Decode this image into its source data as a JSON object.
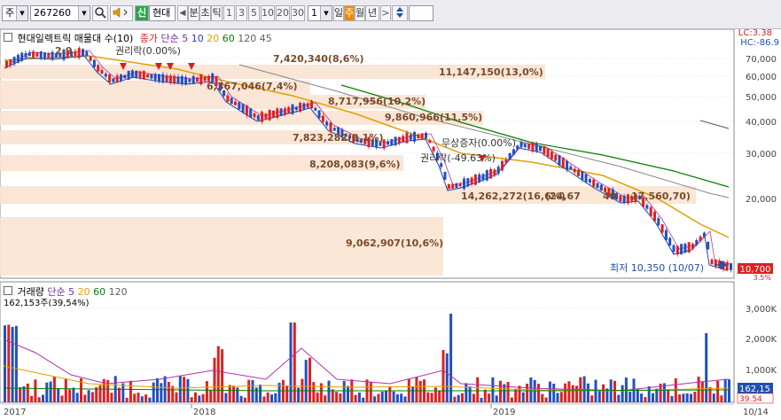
{
  "toolbar": {
    "market": "주",
    "code": "267260",
    "search_icon": "search-icon",
    "speaker_icon": "speaker-icon",
    "new_badge": "신",
    "stock_name": "현대",
    "prev_arrow": "◀",
    "tick_label": "분",
    "tick_label2": "초",
    "tick_label3": "틱",
    "periods": [
      "1",
      "3",
      "5",
      "10",
      "20",
      "30"
    ],
    "count": "1",
    "day": "일",
    "week": "주",
    "month": "월",
    "year": "년",
    "next_arrow": ">",
    "updown_icon": "updown-arrow-icon",
    "colors": {
      "week_active_bg": "#f08a00",
      "day_text": "#333333"
    }
  },
  "price_panel": {
    "title": "현대일렉트릭 매물대 수(10)",
    "legend": [
      {
        "label": "종가",
        "color": "#000000"
      },
      {
        "label": "단순",
        "color": "#7030a0"
      },
      {
        "label": "5",
        "color": "#7030a0"
      },
      {
        "label": "10",
        "color": "#2040c0"
      },
      {
        "label": "20",
        "color": "#e0a000"
      },
      {
        "label": "60",
        "color": "#008000"
      },
      {
        "label": "120",
        "color": "#606060"
      },
      {
        "label": "45",
        "color": "#606060"
      }
    ],
    "lc_label": "LC:3.38",
    "hc_label": "HC:-86.9",
    "y_ticks": [
      "70,000",
      "60,000",
      "50,000",
      "40,000",
      "30,000",
      "20,000"
    ],
    "y_values": [
      70000,
      60000,
      50000,
      40000,
      30000,
      20000
    ],
    "current_price": "10,700",
    "low_label": "최저 10,350 (10/07)",
    "small_pct": "3.5%",
    "annotations": [
      "2,9",
      "권리락(0.00%)",
      "무상증자(0.00%)",
      "권리락(-49.63%)",
      "7,420,340(8,6%)",
      "11,147,150(13,0%)",
      "6,367,046(7,4%)",
      "8,717,956(10,2%)",
      "9,860,966(11,5%)",
      "7,823,282(9,1%)",
      "8,208,083(9,6%)",
      "14,262,272(16,6%)",
      "(24,67",
      "40",
      "17,560,70)",
      "9,062,907(10,6%)"
    ]
  },
  "volume_panel": {
    "title": "거래량",
    "legend": [
      {
        "label": "단순",
        "color": "#7030a0"
      },
      {
        "label": "5",
        "color": "#7030a0"
      },
      {
        "label": "20",
        "color": "#e0a000"
      },
      {
        "label": "60",
        "color": "#008000"
      },
      {
        "label": "120",
        "color": "#606060"
      }
    ],
    "max_label": "162,153주(39,54%)",
    "y_ticks": [
      "3,000K",
      "2,000K",
      "1,000K"
    ],
    "y_values": [
      3000,
      2000,
      1000
    ],
    "current_volume": "162,15",
    "current_pct": "39.54"
  },
  "x_axis": {
    "labels": [
      "2017",
      "2018",
      "2019",
      "10/14"
    ]
  }
}
